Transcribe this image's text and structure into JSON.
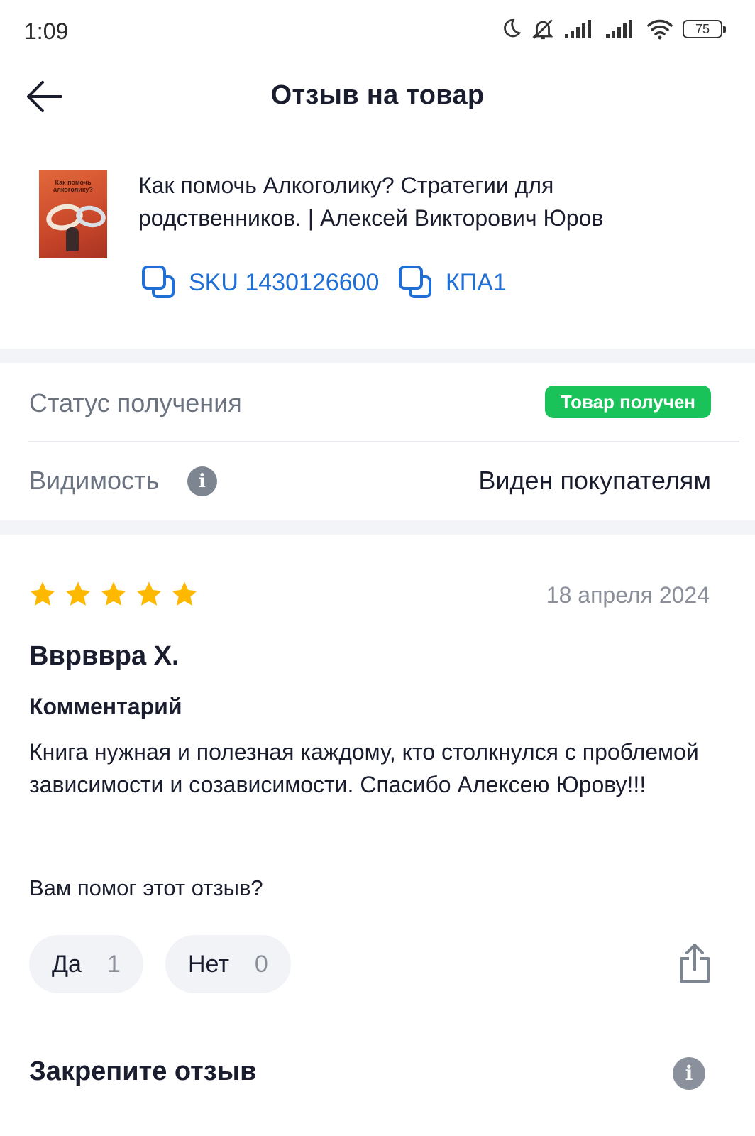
{
  "status_bar": {
    "time": "1:09",
    "battery": "75"
  },
  "header": {
    "title": "Отзыв на товар"
  },
  "product": {
    "name": "Как помочь Алкоголику? Стратегии для родственников. | Алексей Викторович Юров",
    "cover_title": "Как помочь алкоголику?",
    "sku": "SKU 1430126600",
    "code": "КПА1"
  },
  "status": {
    "label": "Статус получения",
    "badge": "Товар получен",
    "badge_color": "#19c35a"
  },
  "visibility": {
    "label": "Видимость",
    "value": "Виден покупателям"
  },
  "review": {
    "rating": 5,
    "date": "18 апреля 2024",
    "author": "Ввpввpa X.",
    "comment_label": "Комментарий",
    "comment": "Книга нужная и полезная каждому, кто столкнулся с проблемой зависимости и созависимости. Спасибо Алексею Юрову!!!",
    "star_color": "#ffb800"
  },
  "helpful": {
    "question": "Вам помог этот отзыв?",
    "yes_label": "Да",
    "yes_count": "1",
    "no_label": "Нет",
    "no_count": "0"
  },
  "pin": {
    "title": "Закрепите отзыв"
  },
  "accent": "#1f6fd6"
}
